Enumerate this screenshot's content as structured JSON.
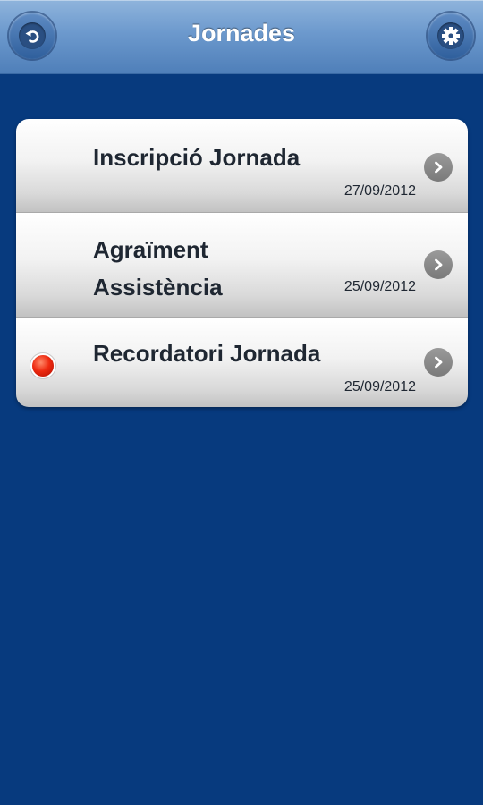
{
  "header": {
    "title": "Jornades",
    "back_icon": "back-arrow-icon",
    "settings_icon": "gear-icon"
  },
  "items": [
    {
      "title": "Inscripció Jornada",
      "date": "27/09/2012",
      "unread": false
    },
    {
      "title": "Agraïment Assistència",
      "title_line1": "Agraïment",
      "title_line2": "Assistència",
      "date": "25/09/2012",
      "unread": false
    },
    {
      "title": "Recordatori Jornada",
      "date": "25/09/2012",
      "unread": true
    }
  ],
  "colors": {
    "background": "#073a7e",
    "header": "#6c99cd",
    "unread_dot": "#ee2a10"
  }
}
